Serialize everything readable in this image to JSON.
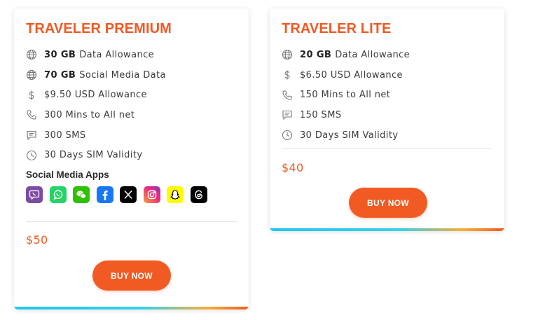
{
  "plans": [
    {
      "title": "TRAVELER PREMIUM",
      "features": [
        {
          "icon": "globe-icon",
          "bold": "30 GB",
          "text": "Data Allowance"
        },
        {
          "icon": "globe-icon",
          "bold": "70 GB",
          "text": "Social Media Data"
        },
        {
          "icon": "dollar-icon",
          "bold": "",
          "text": "$9.50 USD Allowance"
        },
        {
          "icon": "phone-icon",
          "bold": "",
          "text": "300 Mins to All net"
        },
        {
          "icon": "sms-icon",
          "bold": "",
          "text": "300 SMS"
        },
        {
          "icon": "clock-icon",
          "bold": "",
          "text": "30 Days SIM Validity"
        }
      ],
      "apps_heading": "Social Media Apps",
      "apps": [
        "viber-icon",
        "whatsapp-icon",
        "wechat-icon",
        "facebook-icon",
        "x-icon",
        "instagram-icon",
        "snapchat-icon",
        "threads-icon"
      ],
      "price": "$50",
      "buy_label": "BUY NOW"
    },
    {
      "title": "TRAVELER LITE",
      "features": [
        {
          "icon": "globe-icon",
          "bold": "20 GB",
          "text": "Data Allowance"
        },
        {
          "icon": "dollar-icon",
          "bold": "",
          "text": "$6.50 USD Allowance"
        },
        {
          "icon": "phone-icon",
          "bold": "",
          "text": "150 Mins to All net"
        },
        {
          "icon": "sms-icon",
          "bold": "",
          "text": "150 SMS"
        },
        {
          "icon": "clock-icon",
          "bold": "",
          "text": "30 Days SIM Validity"
        }
      ],
      "price": "$40",
      "buy_label": "BUY NOW"
    }
  ],
  "colors": {
    "accent": "#ef5a24",
    "button": "#f25a24",
    "gradient_start": "#1ec8ef",
    "gradient_end": "#f25a22"
  }
}
